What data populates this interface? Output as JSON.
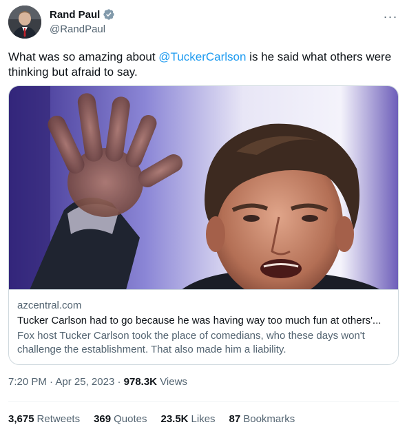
{
  "author": {
    "display_name": "Rand Paul",
    "handle": "@RandPaul",
    "verified_icon": "verified-badge-icon",
    "verified_color": "#1d9bf0"
  },
  "more_icon": "more-options-icon",
  "more_glyph": "···",
  "tweet": {
    "text_before": "What was so amazing about ",
    "mention": "@TuckerCarlson",
    "text_after": " is he said what others were thinking but afraid to say."
  },
  "card": {
    "domain": "azcentral.com",
    "title": "Tucker Carlson had to go because he was having way too much fun at others'...",
    "description": "Fox host Tucker Carlson took the place of comedians, who these days won't challenge the establishment. That also made him a liability."
  },
  "meta": {
    "time": "7:20 PM",
    "separator": "·",
    "date": "Apr 25, 2023",
    "views_count": "978.3K",
    "views_label": "Views"
  },
  "stats": [
    {
      "count": "3,675",
      "label": "Retweets"
    },
    {
      "count": "369",
      "label": "Quotes"
    },
    {
      "count": "23.5K",
      "label": "Likes"
    },
    {
      "count": "87",
      "label": "Bookmarks"
    }
  ],
  "colors": {
    "accent": "#1d9bf0",
    "text_primary": "#0f1419",
    "text_secondary": "#536471",
    "border": "#cfd9de"
  }
}
